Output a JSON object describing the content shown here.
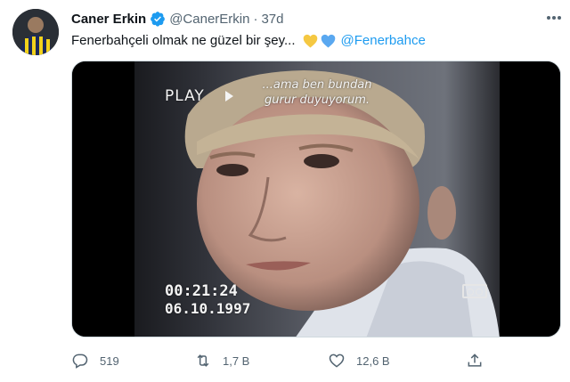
{
  "tweet": {
    "display_name": "Caner Erkin",
    "handle": "@CanerErkin",
    "separator": "·",
    "time": "37d",
    "text": "Fenerbahçeli olmak ne güzel bir şey...",
    "mention": "@Fenerbahce",
    "heart_colors": [
      "#f5c842",
      "#5aa8f0"
    ]
  },
  "media": {
    "play_label": "PLAY",
    "caption_line1": "...ama ben bundan",
    "caption_line2": "gurur duyuyorum.",
    "timecode": "00:21:24",
    "date": "06.10.1997"
  },
  "actions": {
    "replies": "519",
    "retweets": "1,7 B",
    "likes": "12,6 B"
  },
  "colors": {
    "link": "#1d9bf0",
    "verified": "#1d9bf0",
    "muted": "#536471"
  },
  "icons": [
    "verified-badge-icon",
    "more-options-icon",
    "yellow-heart-icon",
    "blue-heart-icon",
    "reply-icon",
    "retweet-icon",
    "like-icon",
    "share-icon",
    "cassette-icon"
  ]
}
